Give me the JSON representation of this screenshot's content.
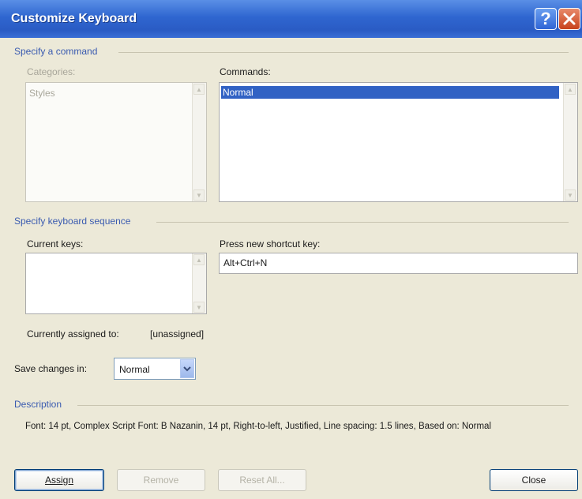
{
  "window": {
    "title": "Customize Keyboard",
    "help_glyph": "?"
  },
  "specify_command": {
    "heading": "Specify a command",
    "categories": {
      "label": "Categories:",
      "items": [
        "Styles"
      ]
    },
    "commands": {
      "label": "Commands:",
      "items": [
        "Normal"
      ],
      "selected": "Normal"
    }
  },
  "keyboard_sequence": {
    "heading": "Specify keyboard sequence",
    "current_keys": {
      "label": "Current keys:",
      "items": []
    },
    "new_shortcut": {
      "label": "Press new shortcut key:",
      "value": "Alt+Ctrl+N"
    },
    "assigned": {
      "label": "Currently assigned to:",
      "value": "[unassigned]"
    }
  },
  "save_changes": {
    "label": "Save changes in:",
    "value": "Normal"
  },
  "description": {
    "heading": "Description",
    "text": "Font: 14 pt, Complex Script Font: B Nazanin, 14 pt, Right-to-left, Justified, Line spacing:  1.5 lines, Based on: Normal"
  },
  "buttons": {
    "assign": "Assign",
    "remove": "Remove",
    "reset_all": "Reset All...",
    "close": "Close"
  },
  "colors": {
    "accent": "#3162c4",
    "title_bar": "#2f66d0",
    "section_heading": "#3a5bb0",
    "dialog_bg": "#ece9d8"
  }
}
